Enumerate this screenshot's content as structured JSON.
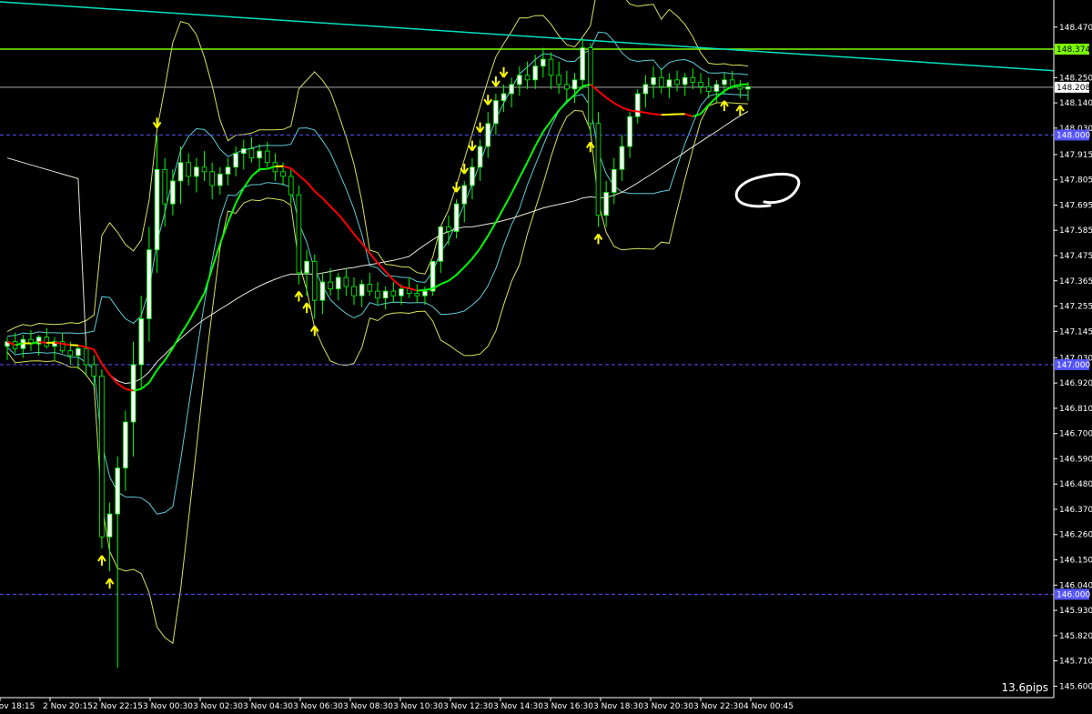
{
  "colors": {
    "background": "#000000",
    "axis": "#ffffff",
    "bull_candle": "#ffffff",
    "bear_candle": "#ffffff",
    "wick": "#00ff00",
    "ma_up": "#00ff00",
    "ma_down": "#ff0000",
    "ma_flat": "#ffff00",
    "bollinger_inner": "#5ecbd6",
    "bollinger_outer": "#d6e05a",
    "long_ma": "#e6e6d8",
    "trendline": "#00e0c0",
    "level_line": "#7cfc00",
    "round_level": "#5555ff",
    "current_price_line": "#c0c0c0",
    "arrow": "#ffff00"
  },
  "price_axis": {
    "ticks": [
      "148.470",
      "148.250",
      "148.140",
      "148.030",
      "147.915",
      "147.805",
      "147.695",
      "147.585",
      "147.475",
      "147.365",
      "147.255",
      "147.145",
      "147.030",
      "146.920",
      "146.810",
      "146.700",
      "146.590",
      "146.480",
      "146.370",
      "146.260",
      "146.150",
      "146.040",
      "145.930",
      "145.820",
      "145.710",
      "145.600"
    ],
    "tick_values": [
      148.47,
      148.25,
      148.14,
      148.03,
      147.915,
      147.805,
      147.695,
      147.585,
      147.475,
      147.365,
      147.255,
      147.145,
      147.03,
      146.92,
      146.81,
      146.7,
      146.59,
      146.48,
      146.37,
      146.26,
      146.15,
      146.04,
      145.93,
      145.82,
      145.71,
      145.6
    ],
    "min": 145.55,
    "max": 148.58
  },
  "time_axis": {
    "labels": [
      "Nov 18:15",
      "2 Nov 20:15",
      "2 Nov 22:15",
      "3 Nov 00:30",
      "3 Nov 02:30",
      "3 Nov 04:30",
      "3 Nov 06:30",
      "3 Nov 08:30",
      "3 Nov 10:30",
      "3 Nov 12:30",
      "3 Nov 14:30",
      "3 Nov 16:30",
      "3 Nov 18:30",
      "3 Nov 20:30",
      "3 Nov 22:30",
      "4 Nov 00:45"
    ]
  },
  "levels": {
    "resistance": {
      "value": 148.374,
      "label": "148.374"
    },
    "current": {
      "value": 148.208,
      "label": "148.208"
    },
    "round_148": {
      "value": 148.0,
      "label": "148.000"
    },
    "round_147": {
      "value": 147.0,
      "label": "147.000"
    },
    "round_146": {
      "value": 146.0,
      "label": "146.000"
    }
  },
  "pips_readout": "13.6pips",
  "chart_data": {
    "type": "candlestick",
    "title": "",
    "xlabel": "",
    "ylabel": "",
    "ylim": [
      145.55,
      148.58
    ],
    "grid": false,
    "candles": [
      [
        147.08,
        147.12,
        147.02,
        147.1
      ],
      [
        147.1,
        147.14,
        147.05,
        147.07
      ],
      [
        147.07,
        147.13,
        147.03,
        147.11
      ],
      [
        147.11,
        147.15,
        147.06,
        147.09
      ],
      [
        147.09,
        147.13,
        147.04,
        147.12
      ],
      [
        147.12,
        147.16,
        147.07,
        147.08
      ],
      [
        147.08,
        147.12,
        147.02,
        147.1
      ],
      [
        147.1,
        147.14,
        147.05,
        147.06
      ],
      [
        147.06,
        147.1,
        147.0,
        147.04
      ],
      [
        147.04,
        147.08,
        146.98,
        147.07
      ],
      [
        147.07,
        147.1,
        146.95,
        147.0
      ],
      [
        147.0,
        147.04,
        146.9,
        146.95
      ],
      [
        146.95,
        146.98,
        146.2,
        146.25
      ],
      [
        146.25,
        146.4,
        146.1,
        146.35
      ],
      [
        146.35,
        146.6,
        145.68,
        146.55
      ],
      [
        146.55,
        146.8,
        146.45,
        146.75
      ],
      [
        146.75,
        147.1,
        146.6,
        147.0
      ],
      [
        147.0,
        147.3,
        146.9,
        147.2
      ],
      [
        147.2,
        147.6,
        147.1,
        147.5
      ],
      [
        147.5,
        148.0,
        147.4,
        147.85
      ],
      [
        147.85,
        147.9,
        147.6,
        147.7
      ],
      [
        147.7,
        147.85,
        147.65,
        147.8
      ],
      [
        147.8,
        147.95,
        147.7,
        147.88
      ],
      [
        147.88,
        147.92,
        147.78,
        147.82
      ],
      [
        147.82,
        147.9,
        147.75,
        147.86
      ],
      [
        147.86,
        147.93,
        147.8,
        147.84
      ],
      [
        147.84,
        147.88,
        147.72,
        147.78
      ],
      [
        147.78,
        147.86,
        147.74,
        147.83
      ],
      [
        147.83,
        147.9,
        147.78,
        147.86
      ],
      [
        147.86,
        147.95,
        147.82,
        147.92
      ],
      [
        147.92,
        147.98,
        147.85,
        147.94
      ],
      [
        147.94,
        147.99,
        147.88,
        147.9
      ],
      [
        147.9,
        147.96,
        147.84,
        147.93
      ],
      [
        147.93,
        147.97,
        147.86,
        147.88
      ],
      [
        147.88,
        147.92,
        147.8,
        147.84
      ],
      [
        147.84,
        147.88,
        147.78,
        147.82
      ],
      [
        147.82,
        147.85,
        147.7,
        147.74
      ],
      [
        147.74,
        147.78,
        147.35,
        147.4
      ],
      [
        147.4,
        147.5,
        147.3,
        147.45
      ],
      [
        147.45,
        147.48,
        147.2,
        147.28
      ],
      [
        147.28,
        147.4,
        147.22,
        147.36
      ],
      [
        147.36,
        147.42,
        147.3,
        147.33
      ],
      [
        147.33,
        147.4,
        147.28,
        147.38
      ],
      [
        147.38,
        147.42,
        147.3,
        147.34
      ],
      [
        147.34,
        147.38,
        147.26,
        147.3
      ],
      [
        147.3,
        147.37,
        147.25,
        147.35
      ],
      [
        147.35,
        147.4,
        147.3,
        147.32
      ],
      [
        147.32,
        147.36,
        147.26,
        147.29
      ],
      [
        147.29,
        147.34,
        147.24,
        147.32
      ],
      [
        147.32,
        147.36,
        147.27,
        147.3
      ],
      [
        147.3,
        147.35,
        147.26,
        147.33
      ],
      [
        147.33,
        147.38,
        147.29,
        147.31
      ],
      [
        147.31,
        147.35,
        147.27,
        147.3
      ],
      [
        147.3,
        147.34,
        147.26,
        147.32
      ],
      [
        147.32,
        147.4,
        147.3,
        147.45
      ],
      [
        147.45,
        147.55,
        147.4,
        147.6
      ],
      [
        147.6,
        147.65,
        147.52,
        147.58
      ],
      [
        147.58,
        147.72,
        147.55,
        147.7
      ],
      [
        147.7,
        147.8,
        147.62,
        147.78
      ],
      [
        147.78,
        147.9,
        147.72,
        147.86
      ],
      [
        147.86,
        147.98,
        147.8,
        147.95
      ],
      [
        147.95,
        148.1,
        147.9,
        148.05
      ],
      [
        148.05,
        148.18,
        148.0,
        148.15
      ],
      [
        148.15,
        148.22,
        148.1,
        148.18
      ],
      [
        148.18,
        148.25,
        148.12,
        148.22
      ],
      [
        148.22,
        148.3,
        148.17,
        148.26
      ],
      [
        148.26,
        148.32,
        148.2,
        148.24
      ],
      [
        148.24,
        148.35,
        148.2,
        148.3
      ],
      [
        148.3,
        148.38,
        148.25,
        148.33
      ],
      [
        148.33,
        148.36,
        148.2,
        148.26
      ],
      [
        148.26,
        148.32,
        148.18,
        148.22
      ],
      [
        148.22,
        148.28,
        148.15,
        148.2
      ],
      [
        148.2,
        148.27,
        148.14,
        148.24
      ],
      [
        148.24,
        148.42,
        148.2,
        148.38
      ],
      [
        148.38,
        148.4,
        148.0,
        148.05
      ],
      [
        148.05,
        148.1,
        147.6,
        147.65
      ],
      [
        147.65,
        147.8,
        147.6,
        147.75
      ],
      [
        147.75,
        147.9,
        147.7,
        147.85
      ],
      [
        147.85,
        148.0,
        147.8,
        147.95
      ],
      [
        147.95,
        148.1,
        147.9,
        148.08
      ],
      [
        148.08,
        148.2,
        148.05,
        148.18
      ],
      [
        148.18,
        148.26,
        148.12,
        148.22
      ],
      [
        148.22,
        148.3,
        148.16,
        148.25
      ],
      [
        148.25,
        148.29,
        148.18,
        148.21
      ],
      [
        148.21,
        148.27,
        148.16,
        148.24
      ],
      [
        148.24,
        148.28,
        148.19,
        148.22
      ],
      [
        148.22,
        148.27,
        148.17,
        148.25
      ],
      [
        148.25,
        148.29,
        148.2,
        148.23
      ],
      [
        148.23,
        148.27,
        148.18,
        148.21
      ],
      [
        148.21,
        148.25,
        148.16,
        148.19
      ],
      [
        148.19,
        148.24,
        148.14,
        148.22
      ],
      [
        148.22,
        148.27,
        148.18,
        148.24
      ],
      [
        148.24,
        148.28,
        148.2,
        148.21
      ],
      [
        148.21,
        148.24,
        148.16,
        148.2
      ],
      [
        148.2,
        148.23,
        148.15,
        148.21
      ]
    ],
    "up_arrow_indices": [
      12,
      13,
      37,
      38,
      39,
      74,
      75,
      91,
      93
    ],
    "down_arrow_indices": [
      19,
      57,
      58,
      59,
      60,
      61,
      62,
      63
    ]
  }
}
